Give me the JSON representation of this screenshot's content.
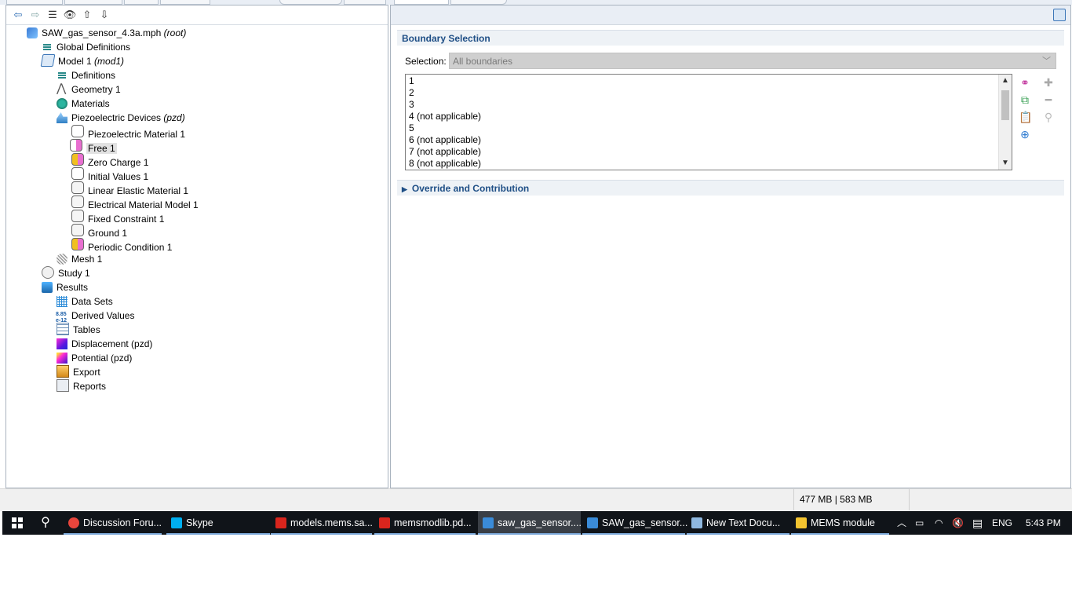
{
  "tree": {
    "root": {
      "label": "SAW_gas_sensor_4.3a.mph",
      "tag": "(root)"
    },
    "global_definitions": "Global Definitions",
    "model": {
      "label": "Model 1",
      "tag": "(mod1)"
    },
    "definitions": "Definitions",
    "geometry": "Geometry 1",
    "materials": "Materials",
    "physics": {
      "label": "Piezoelectric Devices",
      "tag": "(pzd)"
    },
    "physics_children": [
      "Piezoelectric Material 1",
      "Free 1",
      "Zero Charge 1",
      "Initial Values 1",
      "Linear Elastic Material 1",
      "Electrical Material Model 1",
      "Fixed Constraint 1",
      "Ground 1",
      "Periodic Condition 1"
    ],
    "mesh": "Mesh 1",
    "study": "Study 1",
    "results": "Results",
    "results_children": [
      "Data Sets",
      "Derived Values",
      "Tables",
      "Displacement (pzd)",
      "Potential (pzd)",
      "Export",
      "Reports"
    ]
  },
  "settings": {
    "boundary_section": "Boundary Selection",
    "selection_label": "Selection:",
    "selection_value": "All boundaries",
    "boundaries": [
      "1",
      "2",
      "3",
      "4 (not applicable)",
      "5",
      "6 (not applicable)",
      "7 (not applicable)",
      "8 (not applicable)"
    ],
    "override_section": "Override and Contribution"
  },
  "status": {
    "memory": "477 MB | 583 MB"
  },
  "taskbar": {
    "items": [
      {
        "label": "Discussion Foru...",
        "color": "#e8453c"
      },
      {
        "label": "Skype",
        "color": "#00aff0"
      },
      {
        "label": "models.mems.sa...",
        "color": "#d9251d"
      },
      {
        "label": "memsmodlib.pd...",
        "color": "#d9251d"
      },
      {
        "label": "saw_gas_sensor....",
        "color": "#3a8bd8"
      },
      {
        "label": "SAW_gas_sensor...",
        "color": "#3a8bd8"
      },
      {
        "label": "New Text Docu...",
        "color": "#8fb8e0"
      },
      {
        "label": "MEMS module",
        "color": "#f4c430"
      }
    ],
    "lang": "ENG",
    "time": "5:43 PM"
  }
}
